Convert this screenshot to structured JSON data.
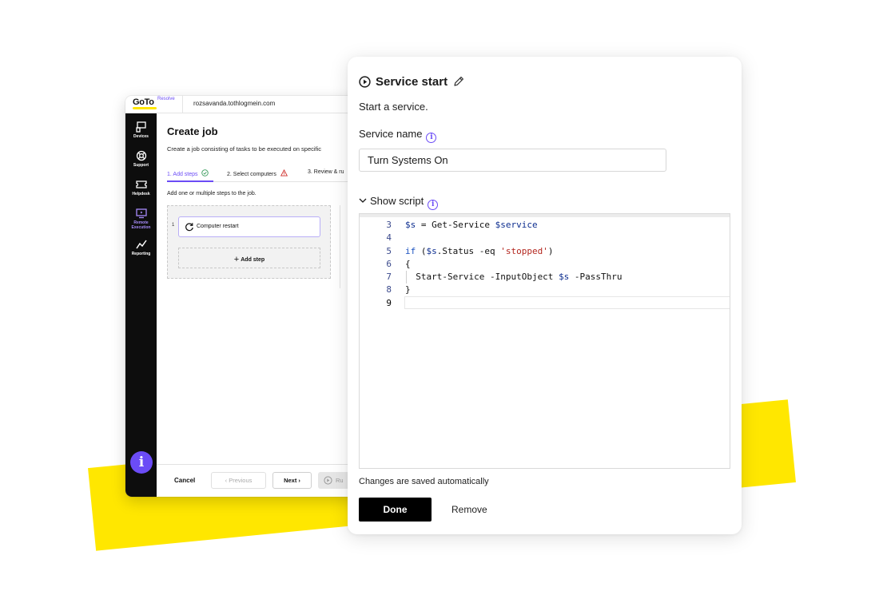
{
  "colors": {
    "accent": "#6b4cf6",
    "brand_yellow": "#ffe700",
    "sidebar_bg": "#0d0d0d"
  },
  "app": {
    "logo": "GoTo",
    "logo_sub": "Resolve",
    "account": "rozsavanda.tothlogmein.com",
    "sidebar": {
      "items": [
        {
          "label": "Devices",
          "icon": "devices-icon"
        },
        {
          "label": "Support",
          "icon": "support-icon"
        },
        {
          "label": "Helpdesk",
          "icon": "helpdesk-icon"
        },
        {
          "label": "Remote Execution",
          "label_line1": "Remote",
          "label_line2": "Execution",
          "icon": "remote-execution-icon",
          "active": true
        },
        {
          "label": "Reporting",
          "icon": "reporting-icon"
        }
      ],
      "info_button": "i"
    },
    "create_job": {
      "title": "Create job",
      "description": "Create a job consisting of tasks to be executed on specific",
      "tabs": [
        {
          "label": "1. Add steps",
          "status": "check"
        },
        {
          "label": "2. Select computers",
          "status": "warning"
        },
        {
          "label": "3. Review & ru",
          "status": ""
        }
      ],
      "hint": "Add one or multiple steps to the job.",
      "steps": [
        {
          "number": "1",
          "label": "Computer restart"
        }
      ],
      "add_step": "Add step"
    },
    "footer": {
      "cancel": "Cancel",
      "previous": "Previous",
      "next": "Next",
      "run": "Ru"
    }
  },
  "panel": {
    "title": "Service start",
    "subtitle": "Start a service.",
    "service_name_label": "Service name",
    "service_name_value": "Turn Systems On",
    "show_script": "Show script",
    "script": {
      "line_numbers": [
        "3",
        "4",
        "5",
        "6",
        "7",
        "8",
        "9"
      ],
      "current_line": "9"
    },
    "saved_note": "Changes are saved automatically",
    "done": "Done",
    "remove": "Remove"
  }
}
